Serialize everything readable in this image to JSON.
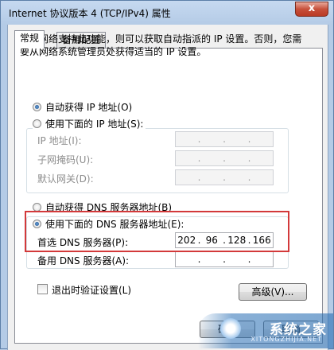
{
  "window": {
    "title": "Internet 协议版本 4 (TCP/IPv4) 属性",
    "close_label": "x"
  },
  "tabs": [
    {
      "label": "常规",
      "active": true
    },
    {
      "label": "备用配置",
      "active": false
    }
  ],
  "description": "如果网络支持此功能，则可以获取自动指派的 IP 设置。否则，您需要从网络系统管理员处获得适当的 IP 设置。",
  "ip_section": {
    "auto_label": "自动获得 IP 地址(O)",
    "manual_label": "使用下面的 IP 地址(S):",
    "auto_selected": true,
    "fields": [
      {
        "label": "IP 地址(I):",
        "value": [
          "",
          "",
          "",
          ""
        ]
      },
      {
        "label": "子网掩码(U):",
        "value": [
          "",
          "",
          "",
          ""
        ]
      },
      {
        "label": "默认网关(D):",
        "value": [
          "",
          "",
          "",
          ""
        ]
      }
    ]
  },
  "dns_section": {
    "auto_label": "自动获得 DNS 服务器地址(B)",
    "manual_label": "使用下面的 DNS 服务器地址(E):",
    "manual_selected": true,
    "preferred": {
      "label": "首选 DNS 服务器(P):",
      "value": [
        "202",
        "96",
        "128",
        "166"
      ]
    },
    "alternate": {
      "label": "备用 DNS 服务器(A):",
      "value": [
        "",
        "",
        "",
        ""
      ]
    }
  },
  "validate_checkbox": {
    "label": "退出时验证设置(L)",
    "checked": false
  },
  "advanced_button": "高级(V)...",
  "ok_button": "确定",
  "cancel_button": "取消",
  "watermark": {
    "text": "系统之家",
    "sub": "XITONGZHIJIA.NET"
  },
  "colors": {
    "highlight": "#d3393a",
    "title_bg": "#c6d9f0"
  }
}
